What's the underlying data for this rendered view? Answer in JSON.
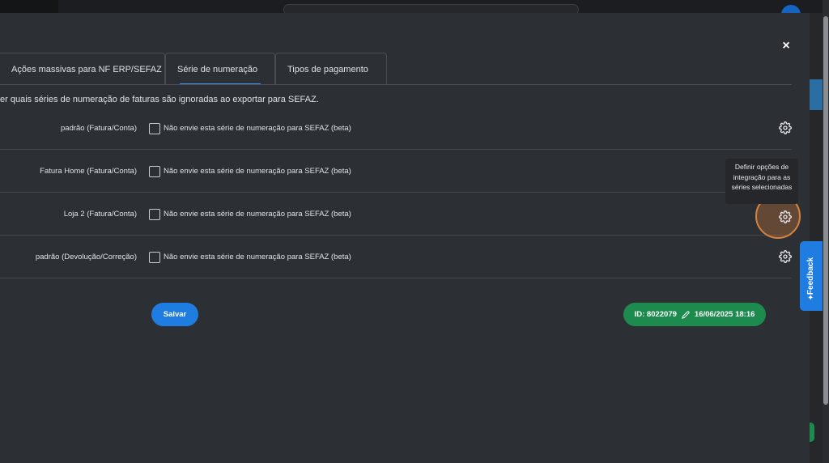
{
  "modal": {
    "close_label": "×",
    "tabs": [
      {
        "label": "Ações massivas para NF ERP/SEFAZ"
      },
      {
        "label": "Série de numeração"
      },
      {
        "label": "Tipos de pagamento"
      }
    ],
    "description": "er quais séries de numeração de faturas são ignoradas ao exportar para SEFAZ.",
    "rows": [
      {
        "label": "padrão (Fatura/Conta)",
        "checkbox_label": "Não envie esta série de numeração para SEFAZ (beta)"
      },
      {
        "label": "Fatura Home (Fatura/Conta)",
        "checkbox_label": "Não envie esta série de numeração para SEFAZ (beta)"
      },
      {
        "label": "Loja 2 (Fatura/Conta)",
        "checkbox_label": "Não envie esta série de numeração para SEFAZ (beta)"
      },
      {
        "label": "padrão (Devolução/Correção)",
        "checkbox_label": "Não envie esta série de numeração para SEFAZ (beta)"
      }
    ],
    "tooltip": "Definir opções de integração para as séries selecionadas",
    "save_label": "Salvar",
    "id_badge": {
      "id_text": "ID: 8022079",
      "date_text": "16/06/2025 18:16"
    }
  },
  "feedback": {
    "label": "Feedback"
  },
  "colors": {
    "modal_bg": "#2c2f33",
    "accent_blue": "#1f7ce0",
    "badge_green": "#1d8a4e",
    "highlight_orange": "#d8823f"
  },
  "icons": [
    "close-icon",
    "gear-icon",
    "pencil-icon",
    "sparkle-icon"
  ]
}
